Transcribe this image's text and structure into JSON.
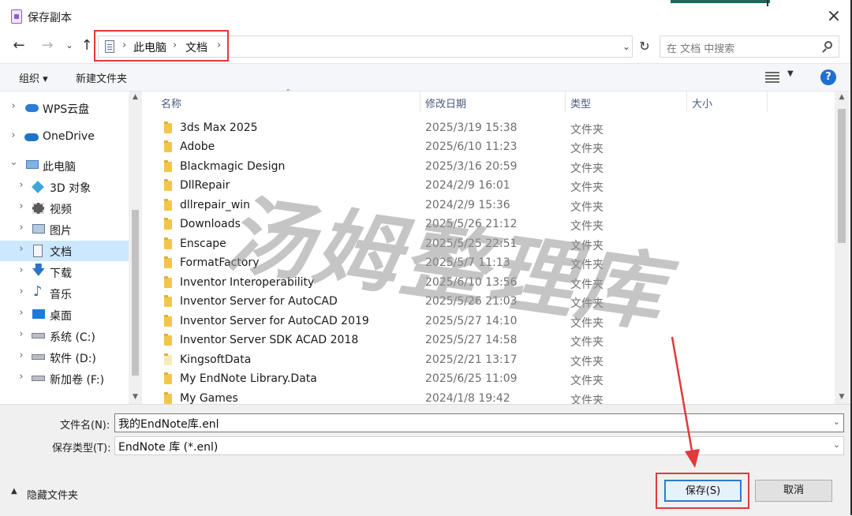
{
  "dialog": {
    "title": "保存副本",
    "close": "×"
  },
  "address": {
    "breadcrumbs": [
      "此电脑",
      "文档"
    ],
    "search_placeholder": "在 文档 中搜索"
  },
  "toolbar": {
    "organize": "组织 ▾",
    "new_folder": "新建文件夹",
    "help": "?"
  },
  "nav": {
    "items": [
      {
        "label": "WPS云盘",
        "icon": "cloud-icon"
      },
      {
        "label": "OneDrive",
        "icon": "onedrive-icon"
      },
      {
        "label": "此电脑",
        "icon": "computer-icon"
      },
      {
        "label": "3D 对象",
        "icon": "cube-icon"
      },
      {
        "label": "视频",
        "icon": "video-icon"
      },
      {
        "label": "图片",
        "icon": "picture-icon"
      },
      {
        "label": "文档",
        "icon": "document-icon"
      },
      {
        "label": "下载",
        "icon": "download-icon"
      },
      {
        "label": "音乐",
        "icon": "music-icon"
      },
      {
        "label": "桌面",
        "icon": "desktop-icon"
      },
      {
        "label": "系统 (C:)",
        "icon": "drive-icon"
      },
      {
        "label": "软件 (D:)",
        "icon": "drive-icon"
      },
      {
        "label": "新加卷 (F:)",
        "icon": "drive-icon"
      }
    ]
  },
  "columns": {
    "name": "名称",
    "modified": "修改日期",
    "type": "类型",
    "size": "大小"
  },
  "files": [
    {
      "name": "3ds Max 2025",
      "date": "2025/3/19 15:38",
      "type": "文件夹"
    },
    {
      "name": "Adobe",
      "date": "2025/6/10 11:23",
      "type": "文件夹"
    },
    {
      "name": "Blackmagic Design",
      "date": "2025/3/16 20:59",
      "type": "文件夹"
    },
    {
      "name": "DllRepair",
      "date": "2024/2/9 16:01",
      "type": "文件夹"
    },
    {
      "name": "dllrepair_win",
      "date": "2024/2/9 15:36",
      "type": "文件夹"
    },
    {
      "name": "Downloads",
      "date": "2025/5/26 21:12",
      "type": "文件夹"
    },
    {
      "name": "Enscape",
      "date": "2025/5/25 22:51",
      "type": "文件夹"
    },
    {
      "name": "FormatFactory",
      "date": "2025/5/7 11:13",
      "type": "文件夹"
    },
    {
      "name": "Inventor Interoperability",
      "date": "2025/6/10 13:56",
      "type": "文件夹"
    },
    {
      "name": "Inventor Server for AutoCAD",
      "date": "2025/5/26 21:03",
      "type": "文件夹"
    },
    {
      "name": "Inventor Server for AutoCAD 2019",
      "date": "2025/5/27 14:10",
      "type": "文件夹"
    },
    {
      "name": "Inventor Server SDK ACAD 2018",
      "date": "2025/5/27 14:58",
      "type": "文件夹"
    },
    {
      "name": "KingsoftData",
      "date": "2025/2/21 13:17",
      "type": "文件夹"
    },
    {
      "name": "My EndNote Library.Data",
      "date": "2025/6/25 11:09",
      "type": "文件夹"
    },
    {
      "name": "My Games",
      "date": "2024/1/8 19:42",
      "type": "文件夹"
    }
  ],
  "watermark": "汤姆整理库",
  "bottom": {
    "filename_label": "文件名(N):",
    "filename_value": "我的EndNote库.enl",
    "filetype_label": "保存类型(T):",
    "filetype_value": "EndNote 库 (*.enl)",
    "hide_folders": "隐藏文件夹",
    "save": "保存(S)",
    "cancel": "取消"
  },
  "colors": {
    "highlight": "#e03a3a",
    "accent": "#1f6fd0",
    "selected_nav": "#cce8ff",
    "folder": "#f3c64b"
  }
}
